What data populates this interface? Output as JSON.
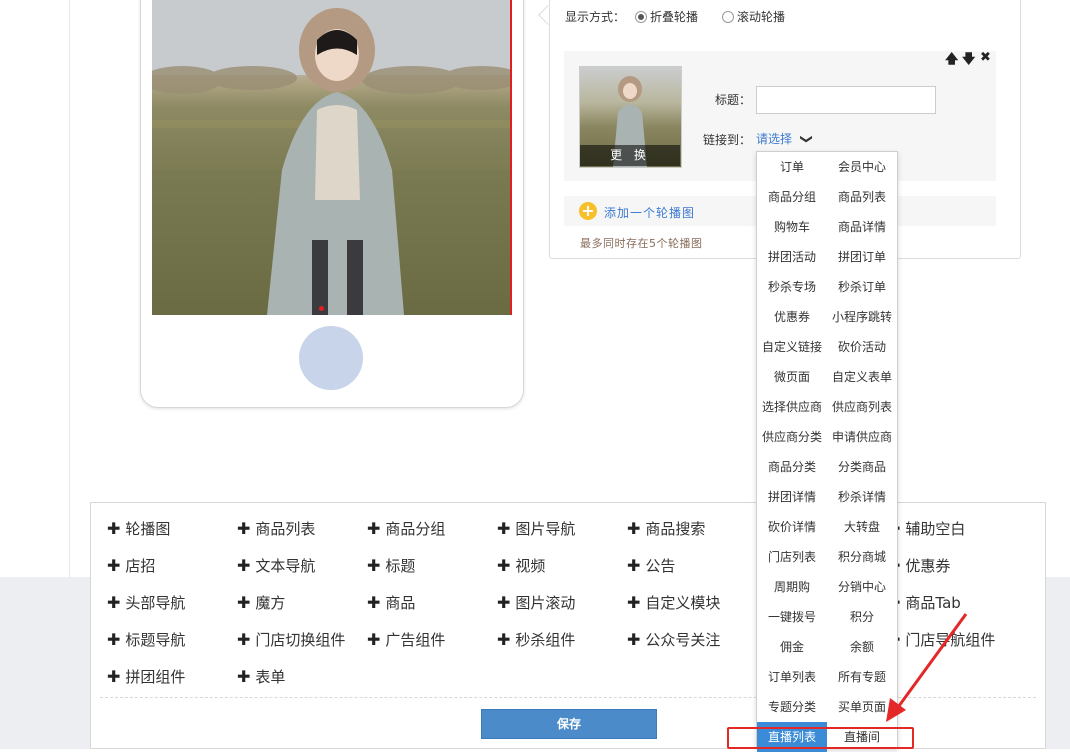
{
  "display_mode": {
    "label": "显示方式：",
    "options": [
      {
        "label": "折叠轮播",
        "checked": true
      },
      {
        "label": "滚动轮播",
        "checked": false
      }
    ]
  },
  "slide_item": {
    "controls": {
      "up": "🡅",
      "down": "🡇",
      "remove": "✖"
    },
    "replace_label": "更 换",
    "title_label": "标题：",
    "title_value": "",
    "link_label": "链接到：",
    "link_value": "请选择",
    "link_chevron": "❯"
  },
  "add_slide": {
    "icon": "+",
    "label": "添加一个轮播图"
  },
  "hint": "最多同时存在5个轮播图",
  "link_dropdown": [
    [
      "订单",
      "会员中心"
    ],
    [
      "商品分组",
      "商品列表"
    ],
    [
      "购物车",
      "商品详情"
    ],
    [
      "拼团活动",
      "拼团订单"
    ],
    [
      "秒杀专场",
      "秒杀订单"
    ],
    [
      "优惠券",
      "小程序跳转"
    ],
    [
      "自定义链接",
      "砍价活动"
    ],
    [
      "微页面",
      "自定义表单"
    ],
    [
      "选择供应商",
      "供应商列表"
    ],
    [
      "供应商分类",
      "申请供应商"
    ],
    [
      "商品分类",
      "分类商品"
    ],
    [
      "拼团详情",
      "秒杀详情"
    ],
    [
      "砍价详情",
      "大转盘"
    ],
    [
      "门店列表",
      "积分商城"
    ],
    [
      "周期购",
      "分销中心"
    ],
    [
      "一键拨号",
      "积分"
    ],
    [
      "佣金",
      "余额"
    ],
    [
      "订单列表",
      "所有专题"
    ],
    [
      "专题分类",
      "买单页面"
    ],
    [
      "直播列表",
      "直播间"
    ]
  ],
  "dropdown_active": "直播列表",
  "components": [
    [
      "轮播图",
      "商品列表",
      "商品分组",
      "图片导航",
      "商品搜索",
      "",
      "辅助空白"
    ],
    [
      "店招",
      "文本导航",
      "标题",
      "视频",
      "公告",
      "",
      "优惠券"
    ],
    [
      "头部导航",
      "魔方",
      "商品",
      "图片滚动",
      "自定义模块",
      "",
      "商品Tab"
    ],
    [
      "标题导航",
      "门店切换组件",
      "广告组件",
      "秒杀组件",
      "公众号关注",
      "",
      "门店导航组件"
    ],
    [
      "拼团组件",
      "表单"
    ]
  ],
  "plus_glyph": "✚",
  "save_label": "保存",
  "colors": {
    "accent": "#4b8bc9",
    "highlight": "#e42828",
    "link": "#3d7bd1",
    "dropdown_active": "#3b8bd6"
  }
}
